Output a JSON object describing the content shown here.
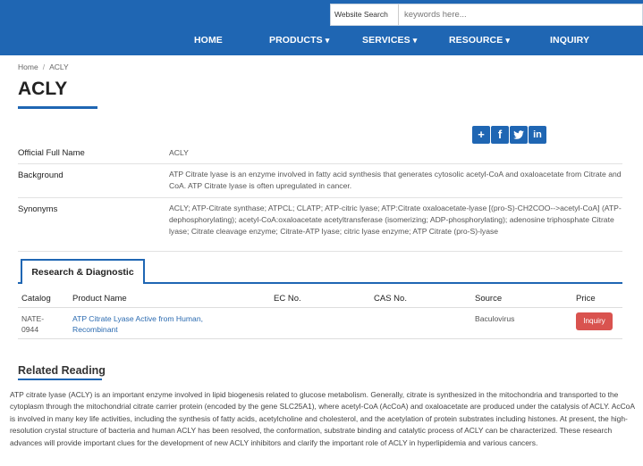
{
  "search": {
    "category": "Website Search",
    "placeholder": "keywords here..."
  },
  "nav": {
    "items": [
      {
        "label": "HOME",
        "dropdown": false
      },
      {
        "label": "PRODUCTS",
        "dropdown": true
      },
      {
        "label": "SERVICES",
        "dropdown": true
      },
      {
        "label": "RESOURCE",
        "dropdown": true
      },
      {
        "label": "INQUIRY",
        "dropdown": false
      }
    ],
    "caret": "▾"
  },
  "breadcrumb": {
    "home": "Home",
    "separator": "/",
    "current": "ACLY"
  },
  "page_title": "ACLY",
  "share": {
    "icons": [
      "plus-share-icon",
      "facebook-icon",
      "twitter-icon",
      "linkedin-icon"
    ],
    "plus_glyph": "+",
    "facebook_glyph": "f",
    "linkedin_glyph": "in"
  },
  "info": {
    "official_name_label": "Official Full Name",
    "official_name_value": "ACLY",
    "background_label": "Background",
    "background_value": "ATP Citrate lyase is an enzyme involved in fatty acid synthesis that generates cytosolic acetyl-CoA and oxaloacetate from Citrate and CoA. ATP Citrate lyase is often upregulated in cancer.",
    "synonyms_label": "Synonyms",
    "synonyms_value": "ACLY; ATP-Citrate synthase; ATPCL; CLATP; ATP-citric lyase; ATP:Citrate oxaloacetate-lyase [(pro-S)-CH2COO-->acetyl-CoA] (ATP-dephosphorylating); acetyl-CoA:oxaloacetate acetyltransferase (isomerizing; ADP-phosphorylating); adenosine triphosphate Citrate lyase; Citrate cleavage enzyme; Citrate-ATP lyase; citric lyase enzyme; ATP Citrate (pro-S)-lyase"
  },
  "tabs": {
    "active": "Research & Diagnostic"
  },
  "product_table": {
    "headers": [
      "Catalog",
      "Product Name",
      "EC No.",
      "CAS No.",
      "Source",
      "Price"
    ],
    "rows": [
      {
        "catalog": "NATE-0944",
        "product_name": "ATP Citrate Lyase Active from Human, Recombinant",
        "ec_no": "",
        "cas_no": "",
        "source": "Baculovirus",
        "price_button": "Inquiry"
      }
    ]
  },
  "related": {
    "title": "Related Reading",
    "text": "ATP citrate lyase (ACLY) is an important enzyme involved in lipid biogenesis related to glucose metabolism. Generally, citrate is synthesized in the mitochondria and transported to the cytoplasm through the mitochondrial citrate carrier protein (encoded by the gene SLC25A1), where acetyl-CoA (AcCoA) and oxaloacetate are produced under the catalysis of ACLY. AcCoA is involved in many key life activities, including the synthesis of fatty acids, acetylcholine and cholesterol, and the acetylation of protein substrates including histones. At present, the high-resolution crystal structure of bacteria and human ACLY has been resolved, the conformation, substrate binding and catalytic process of ACLY can be characterized. These research advances will provide important clues for the development of new ACLY inhibitors and clarify the important role of ACLY in hyperlipidemia and various cancers."
  },
  "colors": {
    "brand_blue": "#1f66b3",
    "inquiry_red": "#d9534f",
    "link_blue": "#2a6ab0"
  }
}
